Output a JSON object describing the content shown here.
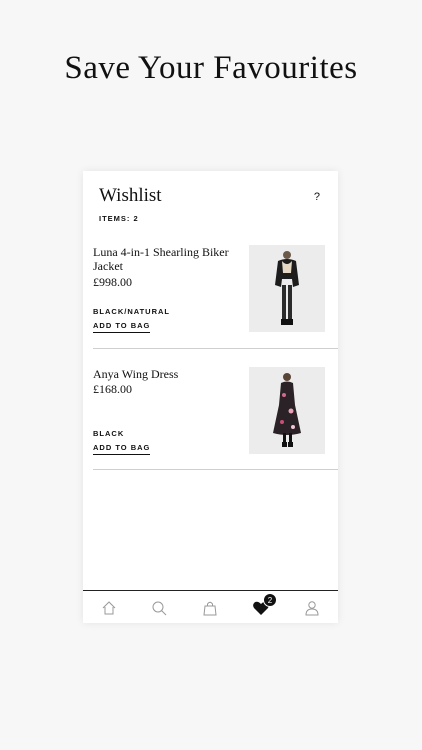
{
  "headline": "Save Your Favourites",
  "wishlist": {
    "title": "Wishlist",
    "help": "?",
    "items_count": "ITEMS: 2",
    "items": [
      {
        "name": "Luna 4-in-1 Shearling Biker Jacket",
        "price": "£998.00",
        "color": "BLACK/NATURAL",
        "action": "ADD TO BAG"
      },
      {
        "name": "Anya Wing Dress",
        "price": "£168.00",
        "color": "BLACK",
        "action": "ADD TO BAG"
      }
    ]
  },
  "tabbar": {
    "items": [
      "home-icon",
      "search-icon",
      "bag-icon",
      "heart-icon",
      "account-icon"
    ],
    "wishlist_badge": "2"
  }
}
